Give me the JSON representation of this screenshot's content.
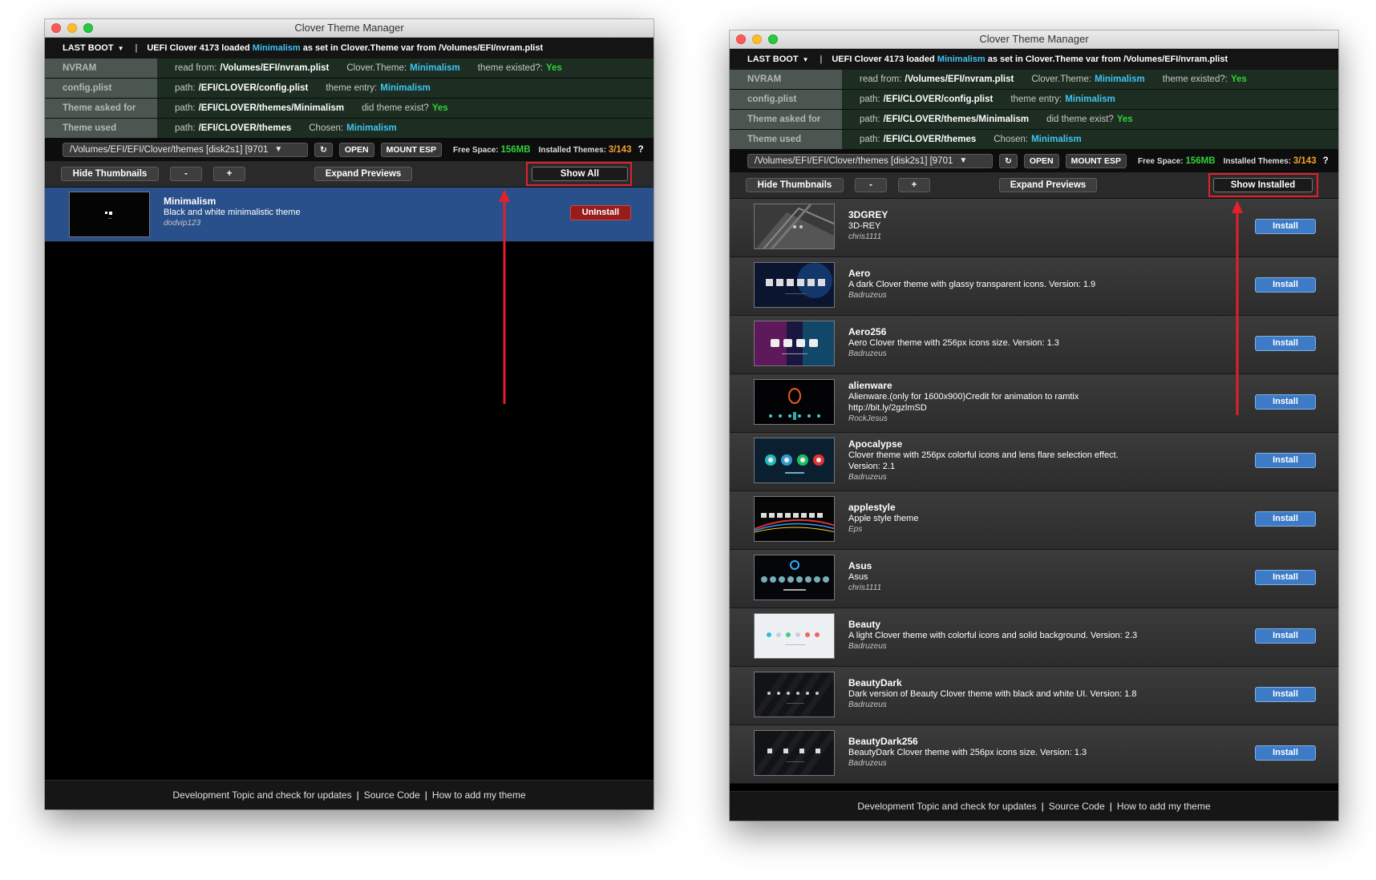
{
  "window_title": "Clover Theme Manager",
  "boot": {
    "label": "LAST BOOT",
    "sep": "|",
    "text_before": "UEFI Clover 4173 loaded",
    "theme": "Minimalism",
    "text_after": "as set in Clover.Theme var from /Volumes/EFI/nvram.plist"
  },
  "info": {
    "nvram": {
      "key": "NVRAM",
      "read_label": "read from:",
      "read_value": "/Volumes/EFI/nvram.plist",
      "theme_label": "Clover.Theme:",
      "theme_value": "Minimalism",
      "existed_label": "theme existed?:",
      "existed_value": "Yes"
    },
    "config": {
      "key": "config.plist",
      "path_label": "path:",
      "path_value": "/EFI/CLOVER/config.plist",
      "entry_label": "theme entry:",
      "entry_value": "Minimalism"
    },
    "asked": {
      "key": "Theme asked for",
      "path_label": "path:",
      "path_value": "/EFI/CLOVER/themes/Minimalism",
      "exist_label": "did theme exist?",
      "exist_value": "Yes"
    },
    "used": {
      "key": "Theme used",
      "path_label": "path:",
      "path_value": "/EFI/CLOVER/themes",
      "chosen_label": "Chosen:",
      "chosen_value": "Minimalism"
    }
  },
  "pathbar": {
    "path": "/Volumes/EFI/EFI/Clover/themes [disk2s1] [9701",
    "refresh": "↻",
    "open": "OPEN",
    "mount": "MOUNT ESP",
    "free_label": "Free Space:",
    "free_value": "156MB",
    "installed_label": "Installed Themes:",
    "installed_value": "3/143",
    "help": "?"
  },
  "toolbar": {
    "hide_thumbs": "Hide Thumbnails",
    "minus": "-",
    "plus": "+",
    "expand": "Expand Previews",
    "show_all": "Show All",
    "show_installed": "Show Installed"
  },
  "left_list": [
    {
      "name": "Minimalism",
      "desc": "Black and white minimalistic theme",
      "author": "dodvip123",
      "action": "UnInstall"
    }
  ],
  "right_list": [
    {
      "name": "3DGREY",
      "desc": "3D-REY",
      "author": "chris1111",
      "action": "Install",
      "thumb": "3dgrey"
    },
    {
      "name": "Aero",
      "desc": "A dark Clover theme with glassy transparent icons. Version: 1.9",
      "author": "Badruzeus",
      "action": "Install",
      "thumb": "aero"
    },
    {
      "name": "Aero256",
      "desc": "Aero Clover theme with 256px icons size. Version: 1.3",
      "author": "Badruzeus",
      "action": "Install",
      "thumb": "aero256"
    },
    {
      "name": "alienware",
      "desc": "Alienware.(only for 1600x900)Credit for animation to ramtix",
      "desc2": "http://bit.ly/2gzlmSD",
      "author": "RockJesus",
      "action": "Install",
      "thumb": "alien"
    },
    {
      "name": "Apocalypse",
      "desc": "Clover theme with 256px colorful icons and lens flare selection effect.",
      "desc2": "Version: 2.1",
      "author": "Badruzeus",
      "action": "Install",
      "thumb": "apoc"
    },
    {
      "name": "applestyle",
      "desc": "Apple style theme",
      "author": "Eps",
      "action": "Install",
      "thumb": "apple"
    },
    {
      "name": "Asus",
      "desc": "Asus",
      "author": "chris1111",
      "action": "Install",
      "thumb": "asus"
    },
    {
      "name": "Beauty",
      "desc": "A light Clover theme with colorful icons and solid background. Version: 2.3",
      "author": "Badruzeus",
      "action": "Install",
      "thumb": "beauty"
    },
    {
      "name": "BeautyDark",
      "desc": "Dark version of Beauty Clover theme with black and white UI. Version: 1.8",
      "author": "Badruzeus",
      "action": "Install",
      "thumb": "bdark"
    },
    {
      "name": "BeautyDark256",
      "desc": "BeautyDark Clover theme with 256px icons size. Version: 1.3",
      "author": "Badruzeus",
      "action": "Install",
      "thumb": "bdark256"
    }
  ],
  "footer": {
    "dev": "Development Topic and check for updates",
    "sep": "|",
    "source": "Source Code",
    "howto": "How to add my theme"
  },
  "colors": {
    "accent_cyan": "#3fc5ef",
    "yes_green": "#31d23b",
    "count_orange": "#f2a12c",
    "install_blue": "#3d7bc6",
    "uninstall_red": "#971c1c",
    "highlight_red": "#e3202b"
  }
}
